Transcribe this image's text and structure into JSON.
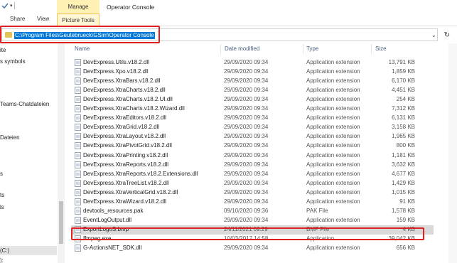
{
  "ribbon": {
    "manage_tab": "Manage",
    "window_title": "Operator Console",
    "tabs": [
      "Share",
      "View"
    ],
    "contextual_tab": "Picture Tools"
  },
  "address": {
    "path": "C:\\Program Files\\Geutebrueck\\GSim\\Operator Console"
  },
  "navigation": {
    "items": [
      "ite",
      "s symbols",
      "Teams-Chatdateien",
      "Dateien",
      "s",
      "ts",
      "ls",
      "(C:)",
      "):"
    ]
  },
  "columns": {
    "name": "Name",
    "date": "Date modified",
    "type": "Type",
    "size": "Size"
  },
  "files": [
    {
      "name": "DevExpress.Utils.v18.2.dll",
      "date": "29/09/2020 09:34",
      "type": "Application extension",
      "size": "13,791 KB"
    },
    {
      "name": "DevExpress.Xpo.v18.2.dll",
      "date": "29/09/2020 09:34",
      "type": "Application extension",
      "size": "1,859 KB"
    },
    {
      "name": "DevExpress.XtraBars.v18.2.dll",
      "date": "29/09/2020 09:34",
      "type": "Application extension",
      "size": "6,170 KB"
    },
    {
      "name": "DevExpress.XtraCharts.v18.2.dll",
      "date": "29/09/2020 09:34",
      "type": "Application extension",
      "size": "4,451 KB"
    },
    {
      "name": "DevExpress.XtraCharts.v18.2.UI.dll",
      "date": "29/09/2020 09:34",
      "type": "Application extension",
      "size": "254 KB"
    },
    {
      "name": "DevExpress.XtraCharts.v18.2.Wizard.dll",
      "date": "29/09/2020 09:34",
      "type": "Application extension",
      "size": "7,312 KB"
    },
    {
      "name": "DevExpress.XtraEditors.v18.2.dll",
      "date": "29/09/2020 09:34",
      "type": "Application extension",
      "size": "6,131 KB"
    },
    {
      "name": "DevExpress.XtraGrid.v18.2.dll",
      "date": "29/09/2020 09:34",
      "type": "Application extension",
      "size": "3,158 KB"
    },
    {
      "name": "DevExpress.XtraLayout.v18.2.dll",
      "date": "29/09/2020 09:34",
      "type": "Application extension",
      "size": "1,965 KB"
    },
    {
      "name": "DevExpress.XtraPivotGrid.v18.2.dll",
      "date": "29/09/2020 09:34",
      "type": "Application extension",
      "size": "800 KB"
    },
    {
      "name": "DevExpress.XtraPrinting.v18.2.dll",
      "date": "29/09/2020 09:34",
      "type": "Application extension",
      "size": "1,181 KB"
    },
    {
      "name": "DevExpress.XtraReports.v18.2.dll",
      "date": "29/09/2020 09:34",
      "type": "Application extension",
      "size": "3,632 KB"
    },
    {
      "name": "DevExpress.XtraReports.v18.2.Extensions.dll",
      "date": "29/09/2020 09:34",
      "type": "Application extension",
      "size": "4,677 KB"
    },
    {
      "name": "DevExpress.XtraTreeList.v18.2.dll",
      "date": "29/09/2020 09:34",
      "type": "Application extension",
      "size": "1,429 KB"
    },
    {
      "name": "DevExpress.XtraVerticalGrid.v18.2.dll",
      "date": "29/09/2020 09:34",
      "type": "Application extension",
      "size": "1,015 KB"
    },
    {
      "name": "DevExpress.XtraWizard.v18.2.dll",
      "date": "29/09/2020 09:34",
      "type": "Application extension",
      "size": "91 KB"
    },
    {
      "name": "devtools_resources.pak",
      "date": "09/10/2020 09:36",
      "type": "PAK File",
      "size": "1,578 KB"
    },
    {
      "name": "EventLogOutput.dll",
      "date": "29/09/2020 09:34",
      "type": "Application extension",
      "size": "159 KB"
    },
    {
      "name": "ExportLogoS.bmp",
      "date": "24/11/2021 09:29",
      "type": "BMP File",
      "size": "4 KB"
    },
    {
      "name": "ffmpeg.exe",
      "date": "10/03/2017 14:58",
      "type": "Application",
      "size": "39,042 KB"
    },
    {
      "name": "G-ActionsNET_SDK.dll",
      "date": "29/09/2020 09:34",
      "type": "Application extension",
      "size": "656 KB"
    }
  ],
  "colors": {
    "accent": "#0078d7",
    "highlight_border": "#e02020",
    "manage_tab": "#fff0b3",
    "selected_row": "#d9d9d9"
  }
}
